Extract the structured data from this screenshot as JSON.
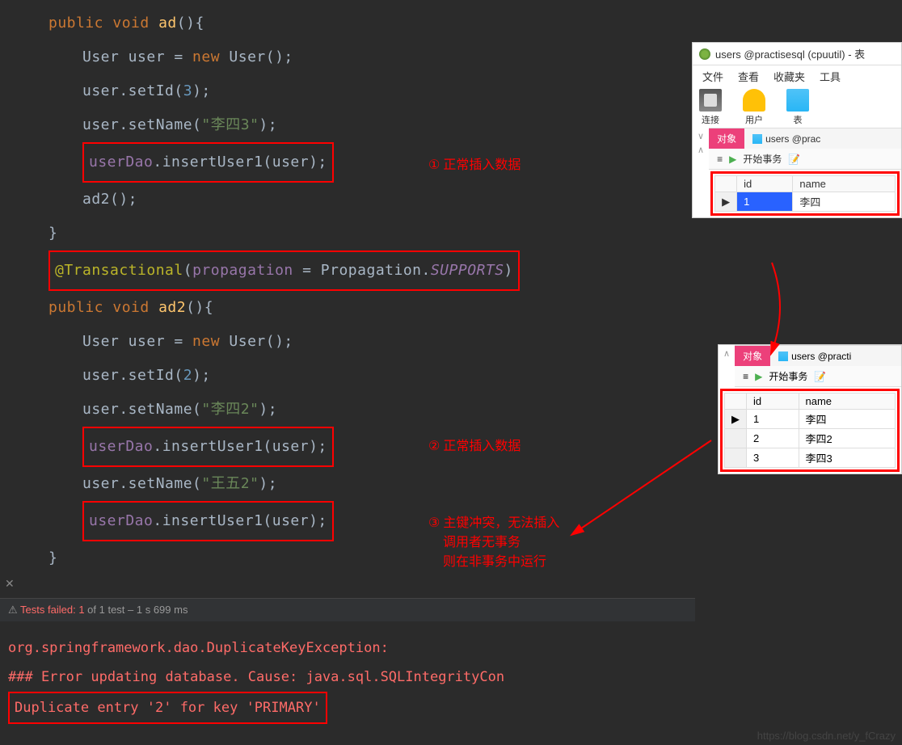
{
  "code": {
    "line1_kw1": "public",
    "line1_kw2": "void",
    "line1_method": "ad",
    "line1_rest": "(){",
    "line2_a": "User user = ",
    "line2_kw": "new",
    "line2_b": " User();",
    "line3_a": "user.setId(",
    "line3_num": "3",
    "line3_b": ");",
    "line4_a": "user.setName(",
    "line4_str": "\"李四3\"",
    "line4_b": ");",
    "line5_a": "userDao",
    "line5_b": ".insertUser1(user);",
    "line6": "ad2();",
    "line7": "}",
    "anno_at": "@Transactional",
    "anno_open": "(",
    "anno_param": "propagation",
    "anno_eq": " = Propagation.",
    "anno_val": "SUPPORTS",
    "anno_close": ")",
    "line9_kw1": "public",
    "line9_kw2": "void",
    "line9_method": "ad2",
    "line9_rest": "(){",
    "line10_a": "User user = ",
    "line10_kw": "new",
    "line10_b": " User();",
    "line11_a": "user.setId(",
    "line11_num": "2",
    "line11_b": ");",
    "line12_a": "user.setName(",
    "line12_str": "\"李四2\"",
    "line12_b": ");",
    "line13_a": "userDao",
    "line13_b": ".insertUser1(user);",
    "line14_a": "user.setName(",
    "line14_str": "\"王五2\"",
    "line14_b": ");",
    "line15_a": "userDao",
    "line15_b": ".insertUser1(user);",
    "line16": "}"
  },
  "annotations": {
    "a1_num": "①",
    "a1_text": "正常插入数据",
    "a2_num": "②",
    "a2_text": "正常插入数据",
    "a3_num": "③",
    "a3_text": "主键冲突，无法插入",
    "a3_line2": "调用者无事务",
    "a3_line3": "则在非事务中运行"
  },
  "test_bar": {
    "label": "Tests failed:",
    "count": "1",
    "of": "of 1 test – 1 s 699 ms"
  },
  "console": {
    "line1": "org.springframework.dao.DuplicateKeyException:",
    "line2": "### Error updating database.  Cause: java.sql.SQLIntegrityCon",
    "line3": "Duplicate entry '2' for key 'PRIMARY'"
  },
  "navicat": {
    "title": "users @practisesql (cpuutil) - 表",
    "menu": [
      "文件",
      "查看",
      "收藏夹",
      "工具"
    ],
    "tools": [
      "连接",
      "用户",
      "表"
    ],
    "tab_active": "对象",
    "tab_other": "users @prac",
    "begin_tx": "开始事务",
    "col_id": "id",
    "col_name": "name",
    "row1_id": "1",
    "row1_name": "李四"
  },
  "navicat2": {
    "tab_active": "对象",
    "tab_other": "users @practi",
    "begin_tx": "开始事务",
    "col_id": "id",
    "col_name": "name",
    "rows": [
      {
        "id": "1",
        "name": "李四"
      },
      {
        "id": "2",
        "name": "李四2"
      },
      {
        "id": "3",
        "name": "李四3"
      }
    ]
  },
  "watermark": "https://blog.csdn.net/y_fCrazy"
}
